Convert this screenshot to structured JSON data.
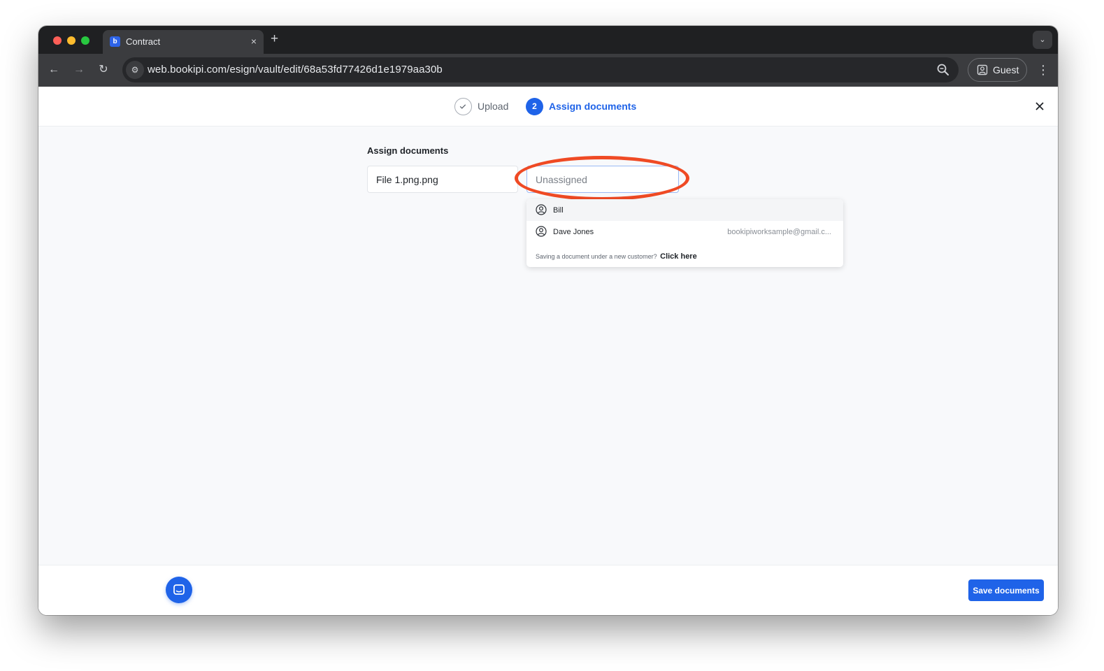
{
  "browser": {
    "tab": {
      "title": "Contract",
      "favicon": "bookipi-logo-icon",
      "close": "×"
    },
    "new_tab": "+",
    "tab_menu": "⌄",
    "nav": {
      "back": "←",
      "forward": "→",
      "reload": "↻"
    },
    "url": "web.bookipi.com/esign/vault/edit/68a53fd77426d1e1979aa30b",
    "profile_label": "Guest",
    "menu": "⋮"
  },
  "stepper": {
    "steps": [
      {
        "label": "Upload",
        "state": "done",
        "marker": "✓"
      },
      {
        "label": "Assign documents",
        "state": "active",
        "marker": "2"
      }
    ]
  },
  "main": {
    "section_title": "Assign documents",
    "file_name": "File 1.png.png",
    "assign_placeholder": "Unassigned",
    "assign_value": ""
  },
  "dropdown": {
    "options": [
      {
        "name": "Bill",
        "email": ""
      },
      {
        "name": "Dave Jones",
        "email": "bookipiworksample@gmail.c..."
      }
    ],
    "footer_text": "Saving a document under a new customer?",
    "footer_link": "Click here"
  },
  "footer": {
    "save_label": "Save documents"
  },
  "colors": {
    "accent": "#1f63e8",
    "highlight_ring": "#ef4a24"
  }
}
